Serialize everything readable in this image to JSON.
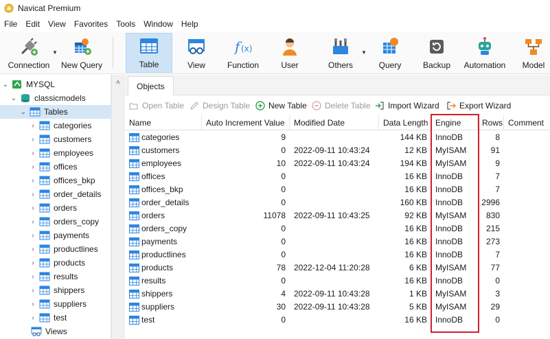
{
  "window": {
    "title": "Navicat Premium"
  },
  "menu": [
    "File",
    "Edit",
    "View",
    "Favorites",
    "Tools",
    "Window",
    "Help"
  ],
  "toolbar": {
    "connection": "Connection",
    "new_query": "New Query",
    "table": "Table",
    "view": "View",
    "function": "Function",
    "user": "User",
    "others": "Others",
    "query": "Query",
    "backup": "Backup",
    "automation": "Automation",
    "model": "Model"
  },
  "sidebar": {
    "connection": "MYSQL",
    "database": "classicmodels",
    "tables_node": "Tables",
    "tables": [
      "categories",
      "customers",
      "employees",
      "offices",
      "offices_bkp",
      "order_details",
      "orders",
      "orders_copy",
      "payments",
      "productlines",
      "products",
      "results",
      "shippers",
      "suppliers",
      "test"
    ],
    "views_node": "Views"
  },
  "tabs": {
    "objects": "Objects"
  },
  "object_toolbar": {
    "open_table": "Open Table",
    "design_table": "Design Table",
    "new_table": "New Table",
    "delete_table": "Delete Table",
    "import_wizard": "Import Wizard",
    "export_wizard": "Export Wizard"
  },
  "grid": {
    "columns": [
      "Name",
      "Auto Increment Value",
      "Modified Date",
      "Data Length",
      "Engine",
      "Rows",
      "Comment"
    ],
    "rows": [
      {
        "name": "categories",
        "auto_inc": "9",
        "modified": "",
        "data_length": "144 KB",
        "engine": "InnoDB",
        "rows": "8"
      },
      {
        "name": "customers",
        "auto_inc": "0",
        "modified": "2022-09-11 10:43:24",
        "data_length": "12 KB",
        "engine": "MyISAM",
        "rows": "91"
      },
      {
        "name": "employees",
        "auto_inc": "10",
        "modified": "2022-09-11 10:43:24",
        "data_length": "194 KB",
        "engine": "MyISAM",
        "rows": "9"
      },
      {
        "name": "offices",
        "auto_inc": "0",
        "modified": "",
        "data_length": "16 KB",
        "engine": "InnoDB",
        "rows": "7"
      },
      {
        "name": "offices_bkp",
        "auto_inc": "0",
        "modified": "",
        "data_length": "16 KB",
        "engine": "InnoDB",
        "rows": "7"
      },
      {
        "name": "order_details",
        "auto_inc": "0",
        "modified": "",
        "data_length": "160 KB",
        "engine": "InnoDB",
        "rows": "2996"
      },
      {
        "name": "orders",
        "auto_inc": "11078",
        "modified": "2022-09-11 10:43:25",
        "data_length": "92 KB",
        "engine": "MyISAM",
        "rows": "830"
      },
      {
        "name": "orders_copy",
        "auto_inc": "0",
        "modified": "",
        "data_length": "16 KB",
        "engine": "InnoDB",
        "rows": "215"
      },
      {
        "name": "payments",
        "auto_inc": "0",
        "modified": "",
        "data_length": "16 KB",
        "engine": "InnoDB",
        "rows": "273"
      },
      {
        "name": "productlines",
        "auto_inc": "0",
        "modified": "",
        "data_length": "16 KB",
        "engine": "InnoDB",
        "rows": "7"
      },
      {
        "name": "products",
        "auto_inc": "78",
        "modified": "2022-12-04 11:20:28",
        "data_length": "6 KB",
        "engine": "MyISAM",
        "rows": "77"
      },
      {
        "name": "results",
        "auto_inc": "0",
        "modified": "",
        "data_length": "16 KB",
        "engine": "InnoDB",
        "rows": "0"
      },
      {
        "name": "shippers",
        "auto_inc": "4",
        "modified": "2022-09-11 10:43:28",
        "data_length": "1 KB",
        "engine": "MyISAM",
        "rows": "3"
      },
      {
        "name": "suppliers",
        "auto_inc": "30",
        "modified": "2022-09-11 10:43:28",
        "data_length": "5 KB",
        "engine": "MyISAM",
        "rows": "29"
      },
      {
        "name": "test",
        "auto_inc": "0",
        "modified": "",
        "data_length": "16 KB",
        "engine": "InnoDB",
        "rows": "0"
      }
    ]
  },
  "colors": {
    "selection": "#cfe3f7",
    "table_icon": "#2e86de",
    "highlight": "#d0202a"
  }
}
